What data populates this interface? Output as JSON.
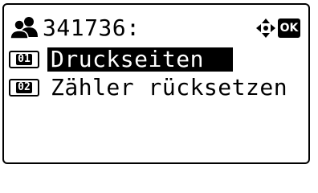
{
  "header": {
    "icon": "users-icon",
    "title": "341736:",
    "nav_icon": "four-way-arrow-icon",
    "ok_label": "OK"
  },
  "menu": {
    "items": [
      {
        "number": "01",
        "label": "Druckseiten",
        "selected": true
      },
      {
        "number": "02",
        "label": "Zähler rücksetzen",
        "selected": false
      }
    ]
  }
}
